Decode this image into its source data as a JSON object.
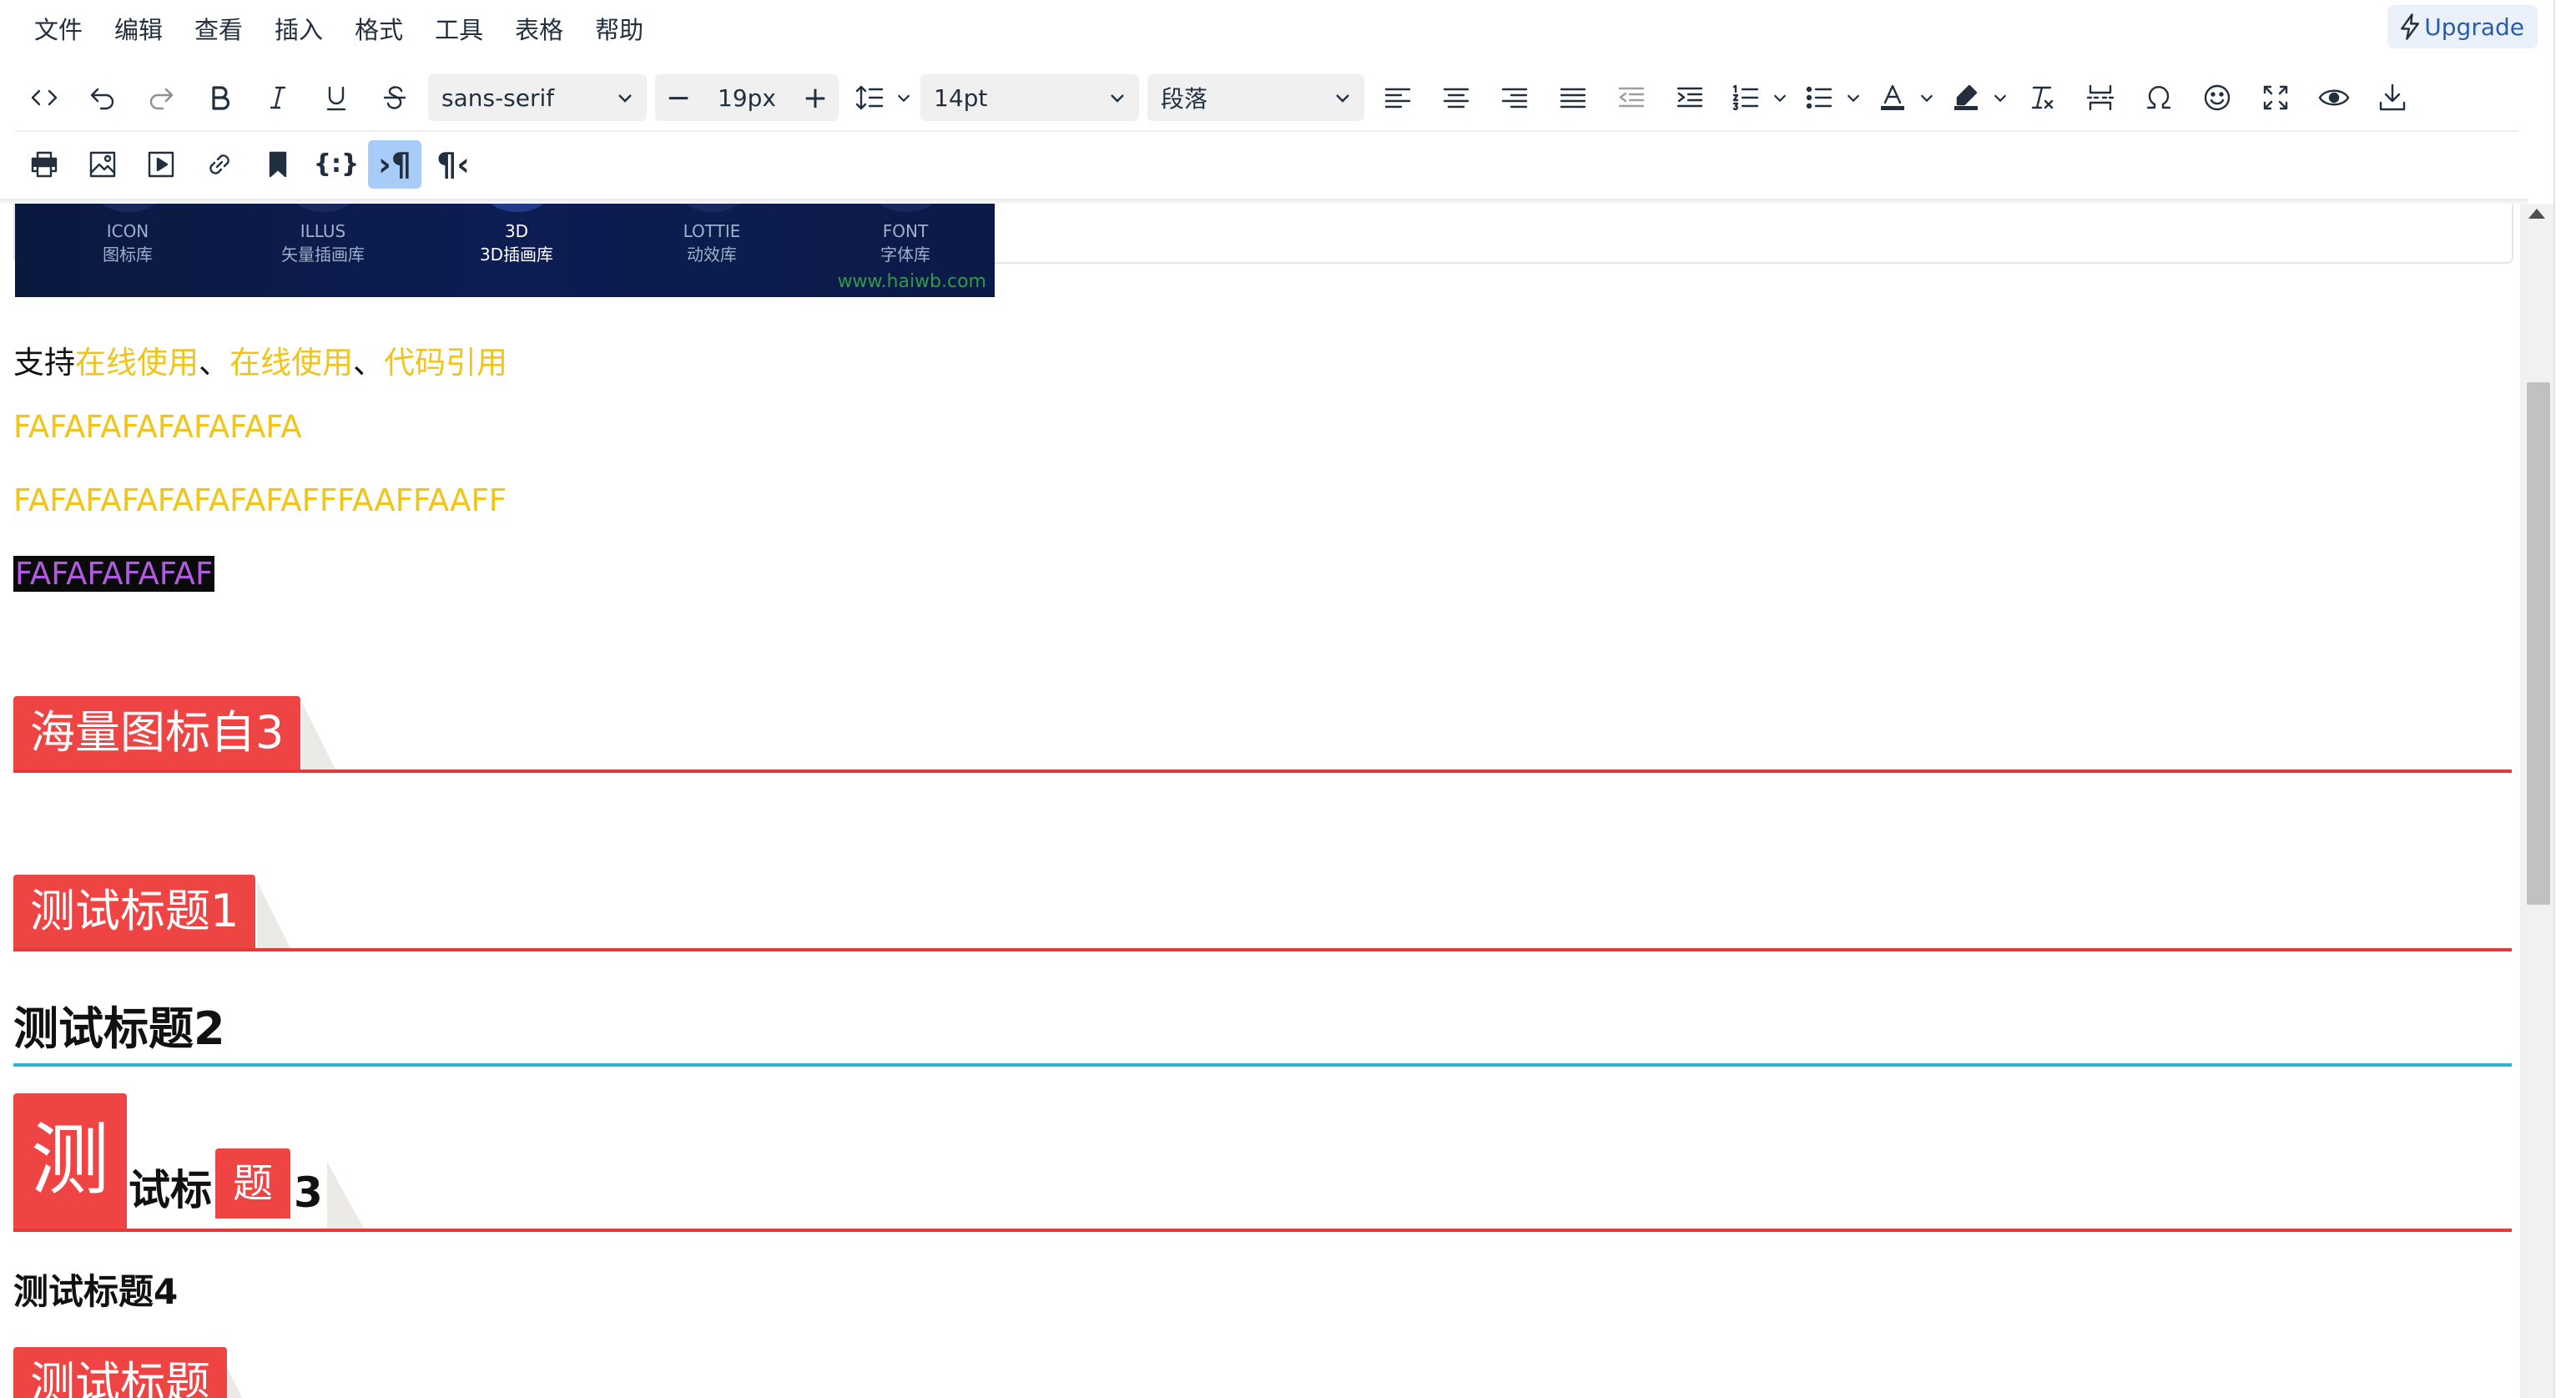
{
  "menubar": {
    "items": [
      "文件",
      "编辑",
      "查看",
      "插入",
      "格式",
      "工具",
      "表格",
      "帮助"
    ],
    "upgrade_label": "Upgrade"
  },
  "toolbar": {
    "font_family": "sans-serif",
    "font_size_step": "19px",
    "font_size": "14pt",
    "block_format": "段落",
    "row1_icons": [
      "code-icon",
      "undo-icon",
      "redo-icon",
      "bold-icon",
      "italic-icon",
      "underline-icon",
      "strikethrough-icon",
      "line-height-icon",
      "align-left-icon",
      "align-center-icon",
      "align-right-icon",
      "align-justify-icon",
      "outdent-icon",
      "indent-icon",
      "numbered-list-icon",
      "bullet-list-icon",
      "text-color-icon",
      "highlight-icon",
      "clear-format-icon",
      "page-break-icon",
      "special-char-icon",
      "emoji-icon",
      "fullscreen-icon",
      "preview-icon",
      "download-icon"
    ],
    "row2_icons": [
      "print-icon",
      "image-icon",
      "media-icon",
      "link-icon",
      "bookmark-icon",
      "template-icon",
      "ltr-icon",
      "rtl-icon"
    ],
    "active": "ltr-icon"
  },
  "banner": {
    "items": [
      {
        "top": "ICON",
        "bottom": "图标库"
      },
      {
        "top": "ILLUS",
        "bottom": "矢量插画库"
      },
      {
        "top": "3D",
        "bottom": "3D插画库"
      },
      {
        "top": "LOTTIE",
        "bottom": "动效库"
      },
      {
        "top": "FONT",
        "bottom": "字体库"
      }
    ],
    "watermark": "www.haiwb.com"
  },
  "content": {
    "support_prefix": "支持",
    "support_link1": "在线使用",
    "sep1": "、",
    "support_link2": "在线使用",
    "sep2": "、",
    "support_link3": "代码引用",
    "fa_line1": "FAFAFAFAFAFAFAFA",
    "fa_line2": "FAFAFAFAFAFAFAFAFFFAAFFAAFF",
    "fa_line3": "FAFAFAFAFAF",
    "heading_a": "海量图标自3",
    "heading_b": "测试标题1",
    "heading_2": "测试标题2",
    "heading_3_big": "测",
    "heading_3_mid": "试标",
    "heading_3_chip": "题",
    "heading_3_end": "3",
    "heading_4": "测试标题4",
    "heading_last": "测试标题"
  },
  "colors": {
    "accent_red": "#ef4444",
    "rule_red": "#e53935",
    "rule_cyan": "#2bb5d1",
    "yellow_text": "#f0c419",
    "purple_text": "#b15ce0",
    "active_button": "#a6ccf7"
  }
}
